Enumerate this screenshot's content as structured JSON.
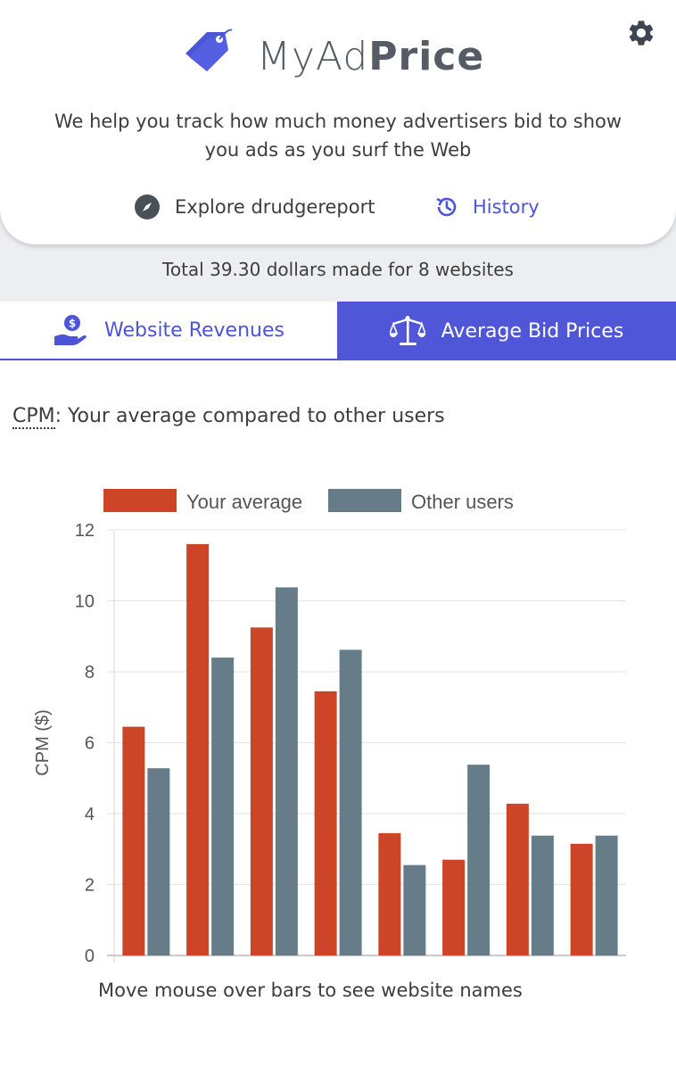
{
  "app": {
    "logo_text_part1": "MyAd",
    "logo_text_part2": "Price",
    "settings_icon": "gear-icon",
    "tagline": "We help you track how much money advertisers bid to show you ads as you surf the Web",
    "explore_label": "Explore drudgereport",
    "history_label": "History",
    "total_summary": "Total 39.30 dollars made for 8 websites"
  },
  "tabs": [
    {
      "label": "Website Revenues",
      "icon": "hand-coin-icon",
      "active": false
    },
    {
      "label": "Average Bid Prices",
      "icon": "scale-icon",
      "active": true
    }
  ],
  "section": {
    "cpm_abbr": "CPM",
    "heading_rest": ": Your average compared to other users",
    "chart_note": "Move mouse over bars to see website names"
  },
  "colors": {
    "accent": "#4f57d8",
    "your_average": "#cc4527",
    "other_users": "#667d89"
  },
  "chart_data": {
    "type": "bar",
    "categories": [
      "",
      "",
      "",
      "",
      "",
      "",
      "",
      ""
    ],
    "series": [
      {
        "name": "Your average",
        "values": [
          6.45,
          11.6,
          9.25,
          7.45,
          3.45,
          2.7,
          4.28,
          3.15
        ]
      },
      {
        "name": "Other users",
        "values": [
          5.28,
          8.4,
          10.38,
          8.62,
          2.55,
          5.38,
          3.38,
          3.38
        ]
      }
    ],
    "ylabel": "CPM ($)",
    "ylim": [
      0,
      12
    ],
    "yticks": [
      0,
      2,
      4,
      6,
      8,
      10,
      12
    ],
    "grid": true,
    "legend": "top"
  }
}
